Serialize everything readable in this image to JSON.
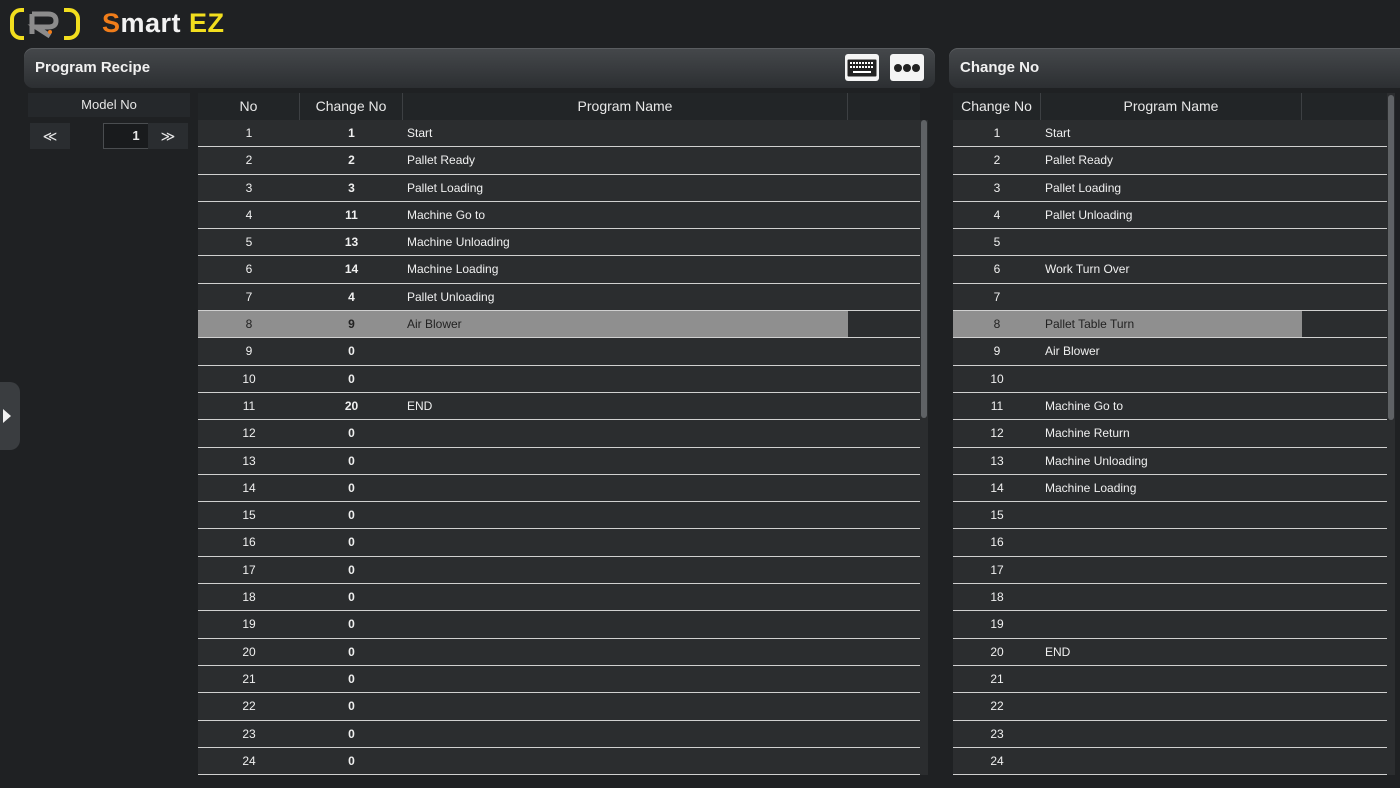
{
  "app": {
    "brand_s": "S",
    "brand_mart": "mart",
    "brand_ez": " EZ"
  },
  "left_panel": {
    "title": "Program Recipe",
    "model_label": "Model No",
    "model_value": "1",
    "prev": "≪",
    "next": "≫",
    "columns": [
      "No",
      "Change No",
      "Program Name"
    ],
    "rows": [
      {
        "no": "1",
        "change": "1",
        "name": "Start"
      },
      {
        "no": "2",
        "change": "2",
        "name": "Pallet Ready"
      },
      {
        "no": "3",
        "change": "3",
        "name": "Pallet Loading"
      },
      {
        "no": "4",
        "change": "11",
        "name": "Machine Go to"
      },
      {
        "no": "5",
        "change": "13",
        "name": "Machine Unloading"
      },
      {
        "no": "6",
        "change": "14",
        "name": "Machine Loading"
      },
      {
        "no": "7",
        "change": "4",
        "name": "Pallet Unloading"
      },
      {
        "no": "8",
        "change": "9",
        "name": "Air Blower",
        "selected": true
      },
      {
        "no": "9",
        "change": "0",
        "name": ""
      },
      {
        "no": "10",
        "change": "0",
        "name": ""
      },
      {
        "no": "11",
        "change": "20",
        "name": "END"
      },
      {
        "no": "12",
        "change": "0",
        "name": ""
      },
      {
        "no": "13",
        "change": "0",
        "name": ""
      },
      {
        "no": "14",
        "change": "0",
        "name": ""
      },
      {
        "no": "15",
        "change": "0",
        "name": ""
      },
      {
        "no": "16",
        "change": "0",
        "name": ""
      },
      {
        "no": "17",
        "change": "0",
        "name": ""
      },
      {
        "no": "18",
        "change": "0",
        "name": ""
      },
      {
        "no": "19",
        "change": "0",
        "name": ""
      },
      {
        "no": "20",
        "change": "0",
        "name": ""
      },
      {
        "no": "21",
        "change": "0",
        "name": ""
      },
      {
        "no": "22",
        "change": "0",
        "name": ""
      },
      {
        "no": "23",
        "change": "0",
        "name": ""
      },
      {
        "no": "24",
        "change": "0",
        "name": ""
      }
    ]
  },
  "right_panel": {
    "title": "Change No",
    "columns": [
      "Change No",
      "Program Name"
    ],
    "rows": [
      {
        "no": "1",
        "name": "Start"
      },
      {
        "no": "2",
        "name": "Pallet Ready"
      },
      {
        "no": "3",
        "name": "Pallet Loading"
      },
      {
        "no": "4",
        "name": "Pallet Unloading"
      },
      {
        "no": "5",
        "name": ""
      },
      {
        "no": "6",
        "name": "Work Turn Over"
      },
      {
        "no": "7",
        "name": ""
      },
      {
        "no": "8",
        "name": "Pallet Table Turn",
        "selected": true
      },
      {
        "no": "9",
        "name": "Air Blower"
      },
      {
        "no": "10",
        "name": ""
      },
      {
        "no": "11",
        "name": "Machine Go to"
      },
      {
        "no": "12",
        "name": "Machine Return"
      },
      {
        "no": "13",
        "name": "Machine Unloading"
      },
      {
        "no": "14",
        "name": "Machine Loading"
      },
      {
        "no": "15",
        "name": ""
      },
      {
        "no": "16",
        "name": ""
      },
      {
        "no": "17",
        "name": ""
      },
      {
        "no": "18",
        "name": ""
      },
      {
        "no": "19",
        "name": ""
      },
      {
        "no": "20",
        "name": "END"
      },
      {
        "no": "21",
        "name": ""
      },
      {
        "no": "22",
        "name": ""
      },
      {
        "no": "23",
        "name": ""
      },
      {
        "no": "24",
        "name": ""
      }
    ]
  },
  "icons": {
    "keyboard": "keyboard-icon",
    "more": "more-icon",
    "side_toggle": "chevron-right-icon"
  },
  "colors": {
    "accent_orange": "#f07d1a",
    "accent_yellow": "#f2de1e",
    "selected_row": "#8f8f8f"
  }
}
